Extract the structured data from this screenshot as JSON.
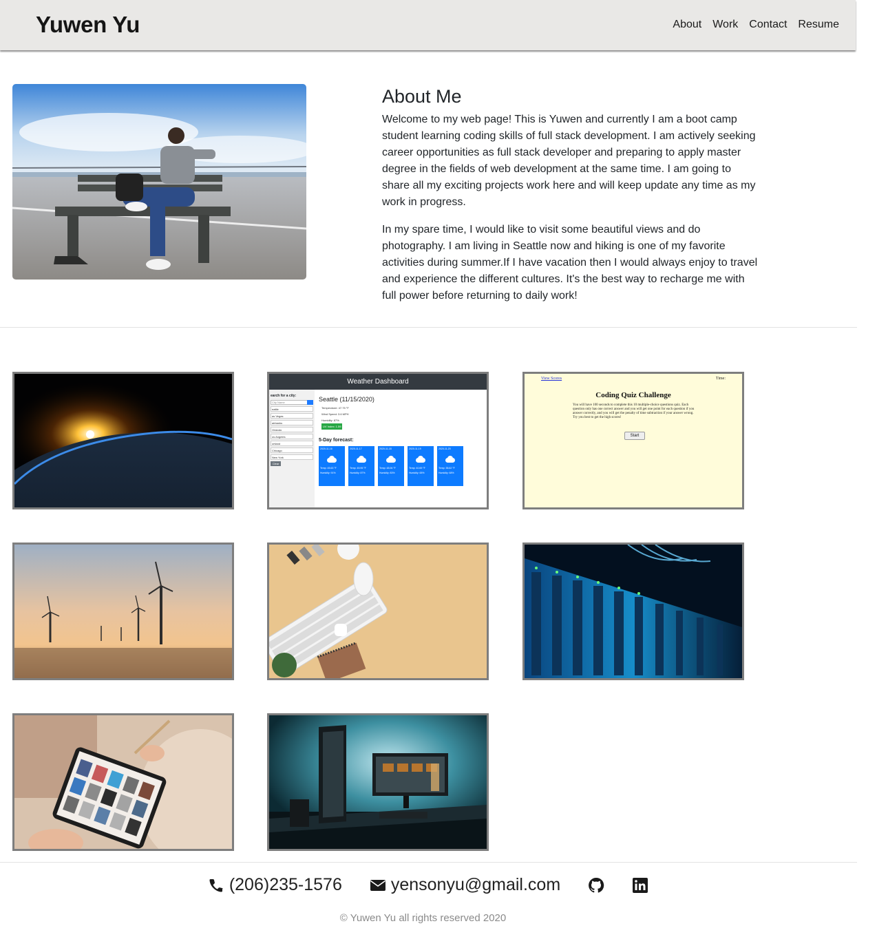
{
  "header": {
    "brand": "Yuwen Yu",
    "nav": [
      "About",
      "Work",
      "Contact",
      "Resume"
    ]
  },
  "about": {
    "title": "About Me",
    "paragraphs": [
      "Welcome to my web page! This is Yuwen and currently I am a boot camp student learning coding skills of full stack development. I am actively seeking career opportunities as full stack developer and preparing to apply master degree in the fields of web development at the same time. I am going to share all my exciting projects work here and will keep update any time as my work in progress.",
      "In my spare time, I would like to visit some beautiful views and do photography. I am living in Seattle now and hiking is one of my favorite activities during summer.If I have vacation then I would always enjoy to travel and experience the different cultures. It's the best way to recharge me with full power before returning to daily work!"
    ]
  },
  "weather": {
    "title": "Weather Dashboard",
    "search_label": "earch for a city:",
    "search_placeholder": "City Name",
    "cities": [
      "eattle",
      "as Vegas",
      "airbanks",
      "Orlando",
      "os Angeles",
      "ortland",
      "Chicago",
      "New York"
    ],
    "clear": "Clear",
    "current": "Seattle (11/15/2020)",
    "temperature": "Temperature: 47.75 °F",
    "wind": "Wind Speed: 3.6 MPH",
    "humidity": "Humidity: 87%",
    "uv": "UV Index: 1.59",
    "forecast_title": "5-Day forecast:",
    "forecast": [
      {
        "date": "2020-11-16",
        "temp": "Temp: 45.63 °F",
        "hum": "Humidity: 91%"
      },
      {
        "date": "2020-11-17",
        "temp": "Temp: 45.95 °F",
        "hum": "Humidity: 87%"
      },
      {
        "date": "2020-11-18",
        "temp": "Temp: 48.06 °F",
        "hum": "Humidity: 83%"
      },
      {
        "date": "2020-11-19",
        "temp": "Temp: 40.69 °F",
        "hum": "Humidity: 65%"
      },
      {
        "date": "2020-11-20",
        "temp": "Temp: 38.62 °F",
        "hum": "Humidity: 68%"
      }
    ]
  },
  "quiz": {
    "view_scores": "View Scores",
    "time": "Time:",
    "title": "Coding Quiz Challenge",
    "description": "You will have 100 seconds to complete this 10 multiple-choice questions quiz. Each question only has one correct answer and you will get one point for each question if you answer correctly, and you will get the penalty of time subtraction if your answer wrong. Try you best to get the high scores!",
    "start": "Start"
  },
  "footer": {
    "phone": "(206)235-1576",
    "email": "yensonyu@gmail.com",
    "copyright": "© Yuwen Yu all rights reserved 2020"
  },
  "icons": {
    "phone": "phone-icon",
    "email": "envelope-icon",
    "github": "github-icon",
    "linkedin": "linkedin-icon"
  }
}
